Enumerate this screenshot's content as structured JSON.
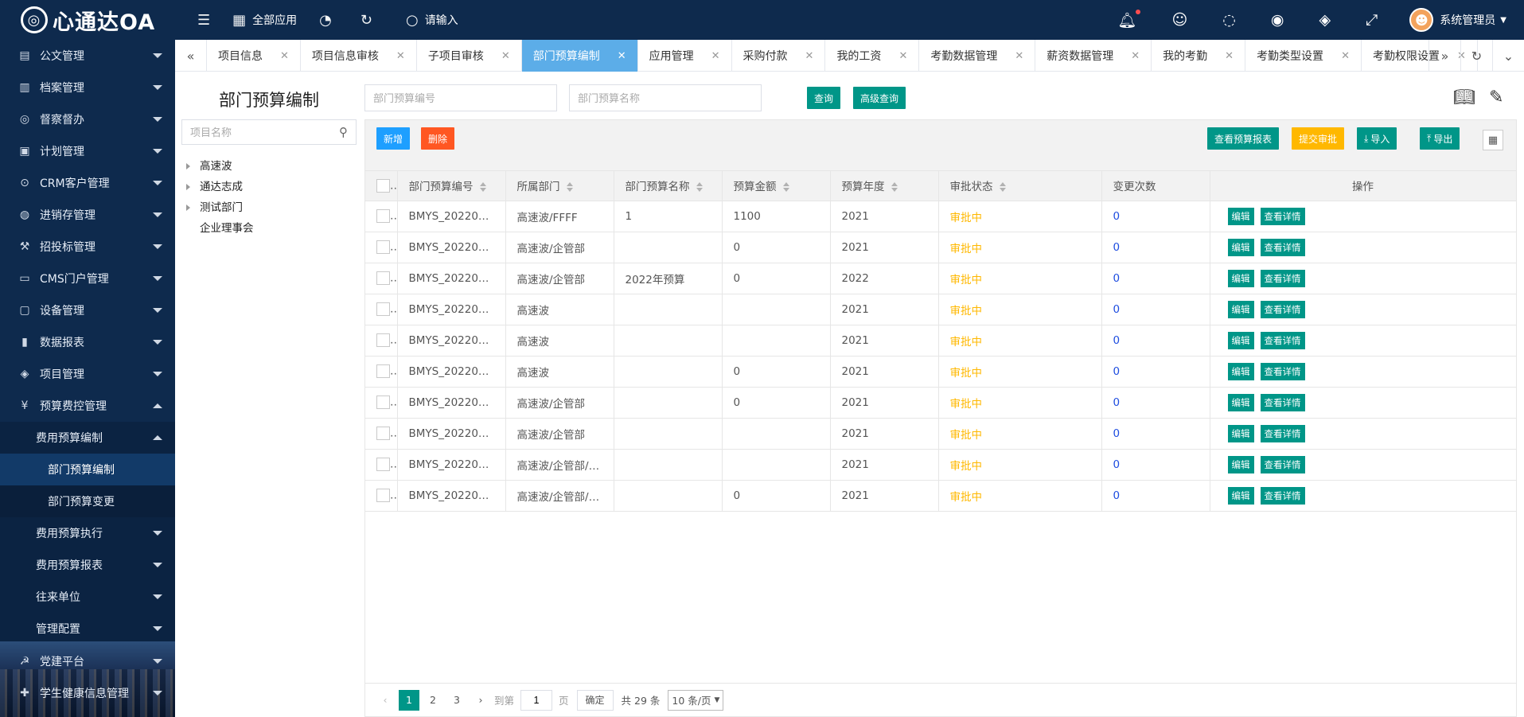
{
  "app": {
    "logo": "心通达OA",
    "logo_mark": "◎"
  },
  "topbar": {
    "all_apps": "全部应用",
    "search_placeholder": "请输入",
    "user_name": "系统管理员"
  },
  "sidebar": {
    "items": [
      {
        "label": "公文管理",
        "icon": "doc-icon"
      },
      {
        "label": "档案管理",
        "icon": "archive-icon"
      },
      {
        "label": "督察督办",
        "icon": "supervise-icon"
      },
      {
        "label": "计划管理",
        "icon": "plan-icon"
      },
      {
        "label": "CRM客户管理",
        "icon": "crm-icon"
      },
      {
        "label": "进销存管理",
        "icon": "inventory-icon"
      },
      {
        "label": "招投标管理",
        "icon": "bid-icon"
      },
      {
        "label": "CMS门户管理",
        "icon": "cms-icon"
      },
      {
        "label": "设备管理",
        "icon": "device-icon"
      },
      {
        "label": "数据报表",
        "icon": "chart-icon"
      },
      {
        "label": "项目管理",
        "icon": "layers-icon"
      },
      {
        "label": "预算费控管理",
        "icon": "budget-icon"
      }
    ],
    "sub_expanded": "费用预算编制",
    "sub2": [
      "部门预算编制",
      "部门预算变更"
    ],
    "sub_items": [
      "费用预算执行",
      "费用预算报表",
      "往来单位",
      "管理配置"
    ],
    "bottom": [
      "党建平台",
      "学生健康信息管理"
    ]
  },
  "tabs": [
    "项目信息",
    "项目信息审核",
    "子项目审核",
    "部门预算编制",
    "应用管理",
    "采购付款",
    "我的工资",
    "考勤数据管理",
    "薪资数据管理",
    "我的考勤",
    "考勤类型设置",
    "考勤权限设置"
  ],
  "tree": {
    "title": "部门预算编制",
    "search_placeholder": "项目名称",
    "nodes": [
      "高速波",
      "通达志成",
      "测试部门",
      "企业理事会"
    ]
  },
  "filters": {
    "code_placeholder": "部门预算编号",
    "name_placeholder": "部门预算名称",
    "query": "查询",
    "advanced": "高级查询"
  },
  "toolbar": {
    "add": "新增",
    "delete": "删除",
    "view_report": "查看预算报表",
    "submit": "提交审批",
    "import": "导入",
    "export": "导出"
  },
  "table": {
    "headers": [
      "部门预算编号",
      "所属部门",
      "部门预算名称",
      "预算金额",
      "预算年度",
      "审批状态",
      "变更次数",
      "操作"
    ],
    "edit": "编辑",
    "detail": "查看详情",
    "rows": [
      {
        "code": "BMYS_202202_00...",
        "dept": "高速波/FFFF",
        "name": "1",
        "amount": "1100",
        "year": "2021",
        "status": "审批中",
        "changes": "0"
      },
      {
        "code": "BMYS_202202_00...",
        "dept": "高速波/企管部",
        "name": "",
        "amount": "0",
        "year": "2021",
        "status": "审批中",
        "changes": "0"
      },
      {
        "code": "BMYS_202202_00...",
        "dept": "高速波/企管部",
        "name": "2022年预算",
        "amount": "0",
        "year": "2022",
        "status": "审批中",
        "changes": "0"
      },
      {
        "code": "BMYS_202202_00...",
        "dept": "高速波",
        "name": "",
        "amount": "",
        "year": "2021",
        "status": "审批中",
        "changes": "0"
      },
      {
        "code": "BMYS_202202_00...",
        "dept": "高速波",
        "name": "",
        "amount": "",
        "year": "2021",
        "status": "审批中",
        "changes": "0"
      },
      {
        "code": "BMYS_202202_00...",
        "dept": "高速波",
        "name": "",
        "amount": "0",
        "year": "2021",
        "status": "审批中",
        "changes": "0"
      },
      {
        "code": "BMYS_202202_00...",
        "dept": "高速波/企管部",
        "name": "",
        "amount": "0",
        "year": "2021",
        "status": "审批中",
        "changes": "0"
      },
      {
        "code": "BMYS_202202_00...",
        "dept": "高速波/企管部",
        "name": "",
        "amount": "",
        "year": "2021",
        "status": "审批中",
        "changes": "0"
      },
      {
        "code": "BMYS_202202_00...",
        "dept": "高速波/企管部/新...",
        "name": "",
        "amount": "",
        "year": "2021",
        "status": "审批中",
        "changes": "0"
      },
      {
        "code": "BMYS_202202_00...",
        "dept": "高速波/企管部/新...",
        "name": "",
        "amount": "0",
        "year": "2021",
        "status": "审批中",
        "changes": "0"
      }
    ]
  },
  "pager": {
    "pages": [
      "1",
      "2",
      "3"
    ],
    "goto_label": "到第",
    "page_value": "1",
    "page_unit": "页",
    "confirm": "确定",
    "total": "共 29 条",
    "per_page": "10 条/页"
  }
}
